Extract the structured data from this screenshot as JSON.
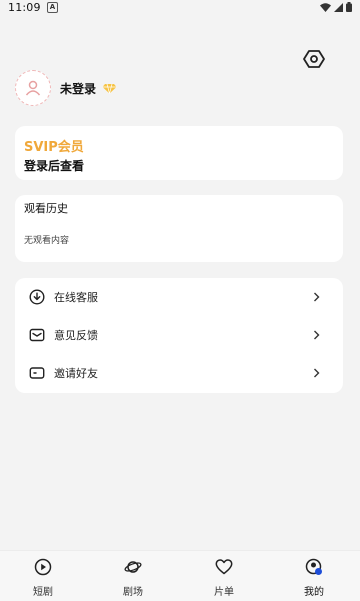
{
  "status_bar": {
    "time": "11:09",
    "notif_letter": "A"
  },
  "profile": {
    "login_label": "未登录"
  },
  "svip": {
    "title": "SVIP会员",
    "subtitle": "登录后查看"
  },
  "history": {
    "title": "观看历史",
    "empty_text": "无观看内容"
  },
  "menu": {
    "items": [
      {
        "label": "在线客服",
        "icon": "download-circle-icon"
      },
      {
        "label": "意见反馈",
        "icon": "feedback-mail-icon"
      },
      {
        "label": "邀请好友",
        "icon": "invite-ticket-icon"
      }
    ]
  },
  "nav": {
    "items": [
      {
        "label": "短剧",
        "icon": "play-circle-icon"
      },
      {
        "label": "剧场",
        "icon": "planet-icon"
      },
      {
        "label": "片单",
        "icon": "heart-icon"
      },
      {
        "label": "我的",
        "icon": "profile-icon",
        "active": true
      }
    ]
  },
  "colors": {
    "svip_accent": "#f0a83a",
    "vip_badge": "#f6c344",
    "active_dot": "#1e4ed8"
  }
}
